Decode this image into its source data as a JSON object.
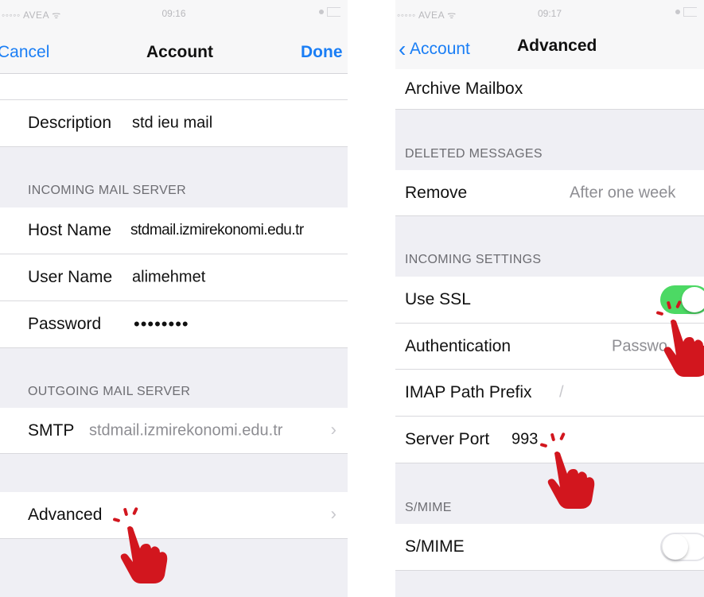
{
  "left_screen": {
    "status": {
      "carrier": "◦◦◦◦◦ AVEA ᯤ",
      "time": "09:16"
    },
    "nav": {
      "cancel": "Cancel",
      "title": "Account",
      "done": "Done"
    },
    "description": {
      "label": "Description",
      "value": "std ieu mail"
    },
    "incoming_header": "INCOMING MAIL SERVER",
    "host": {
      "label": "Host Name",
      "value": "stdmail.izmirekonomi.edu.tr"
    },
    "user": {
      "label": "User Name",
      "value": "alimehmet"
    },
    "password": {
      "label": "Password",
      "value": "••••••••"
    },
    "outgoing_header": "OUTGOING MAIL SERVER",
    "smtp": {
      "label": "SMTP",
      "value": "stdmail.izmirekonomi.edu.tr"
    },
    "advanced": {
      "label": "Advanced"
    },
    "chevron": "›"
  },
  "right_screen": {
    "status": {
      "carrier": "◦◦◦◦◦ AVEA ᯤ",
      "time": "09:17"
    },
    "nav": {
      "back": "Account",
      "title": "Advanced"
    },
    "archive": {
      "label": "Archive Mailbox"
    },
    "deleted_header": "DELETED MESSAGES",
    "remove": {
      "label": "Remove",
      "value": "After one week"
    },
    "incoming_settings_header": "INCOMING SETTINGS",
    "use_ssl": {
      "label": "Use SSL",
      "on": true
    },
    "auth": {
      "label": "Authentication",
      "value": "Passwo"
    },
    "imap": {
      "label": "IMAP Path Prefix",
      "value": "/"
    },
    "port": {
      "label": "Server Port",
      "value": "993"
    },
    "smime_header": "S/MIME",
    "smime": {
      "label": "S/MIME",
      "on": false
    }
  },
  "colors": {
    "accent": "#1a7ef5",
    "toggle_on": "#4cd964",
    "hand": "#d2161e"
  }
}
